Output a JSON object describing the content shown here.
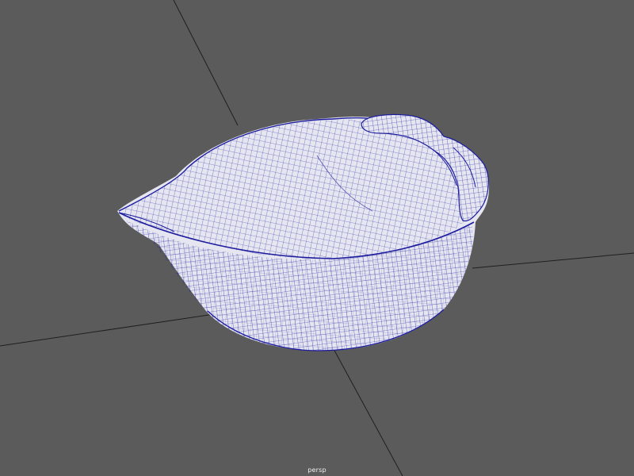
{
  "viewport": {
    "camera_label": "persp",
    "background_color": "#5b5b5b",
    "grid_line_color": "#1f1f1f",
    "mesh_fill_color": "#e6e6f1",
    "mesh_wire_color": "#1d1d9e"
  }
}
